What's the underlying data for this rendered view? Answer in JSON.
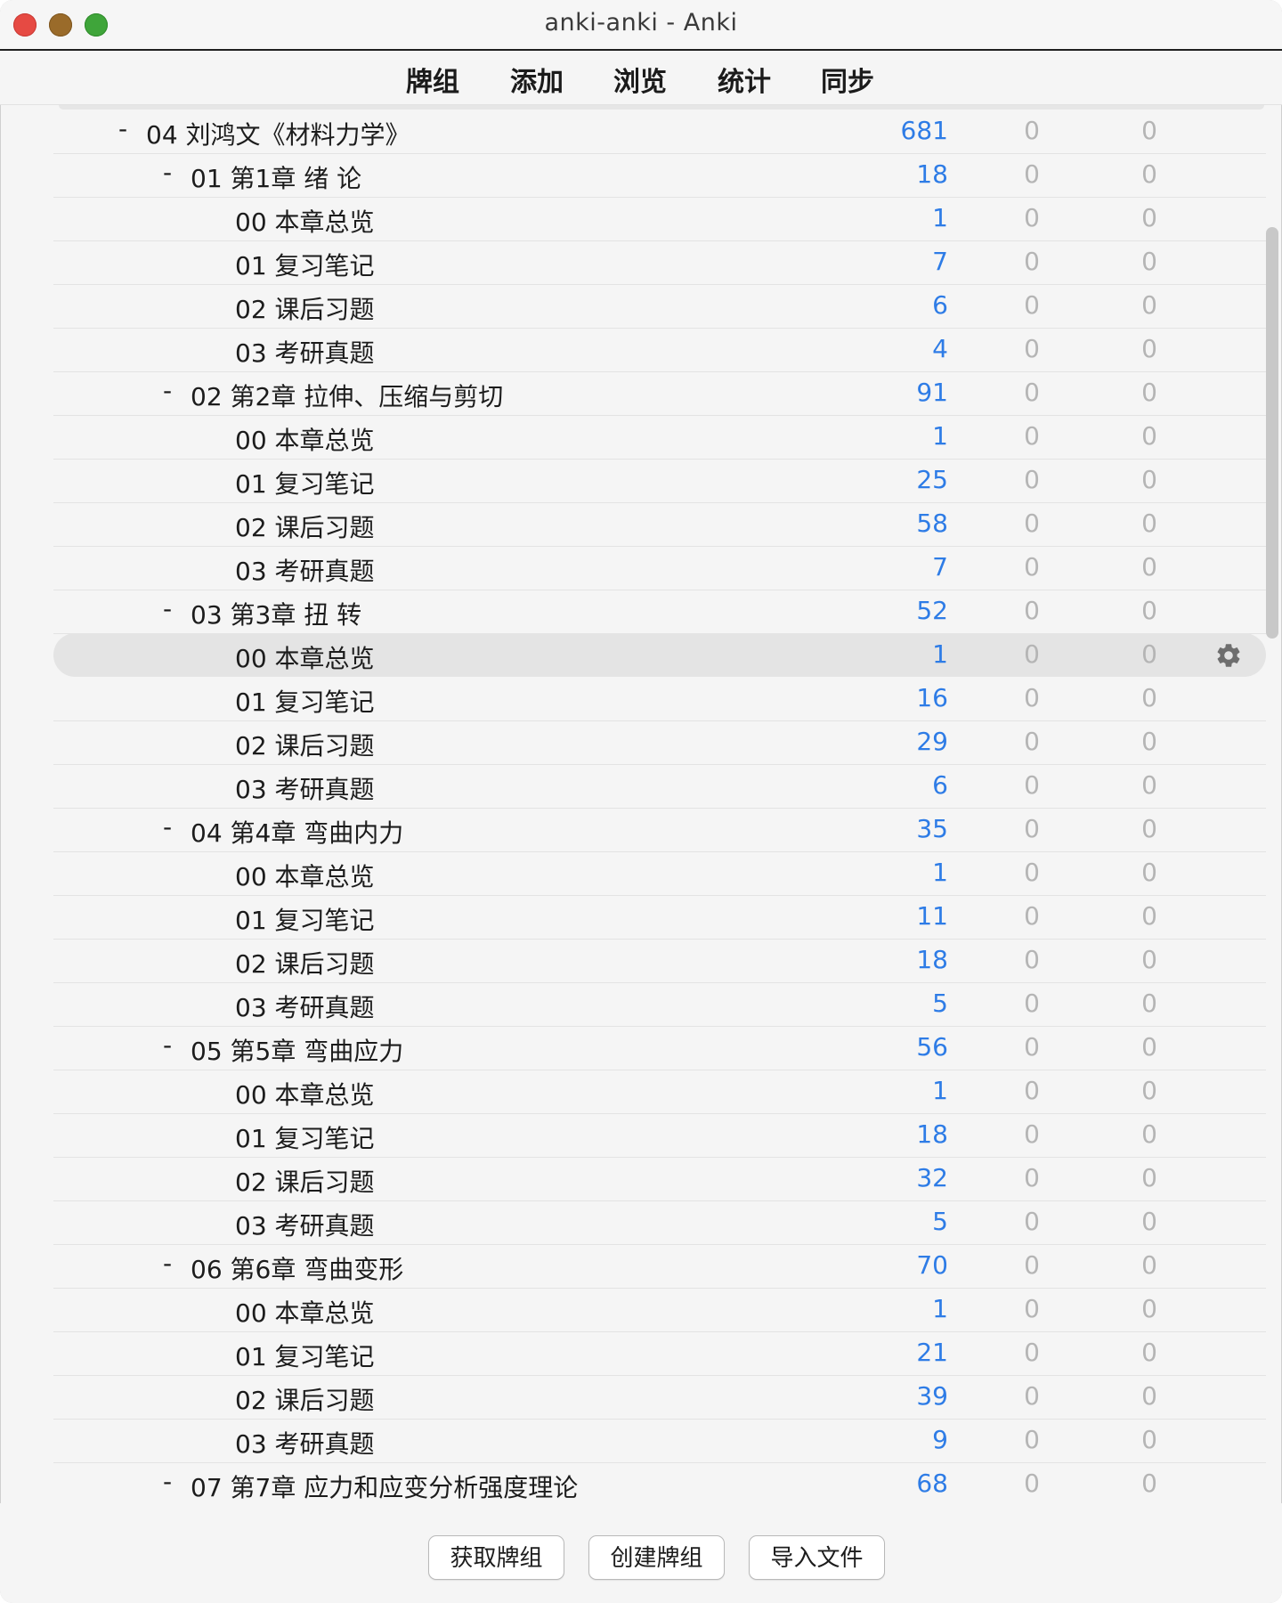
{
  "window": {
    "title": "anki-anki - Anki"
  },
  "toolbar": {
    "decks": "牌组",
    "add": "添加",
    "browse": "浏览",
    "stats": "统计",
    "sync": "同步"
  },
  "decks": [
    {
      "level": 0,
      "collapse": "-",
      "name": "04 刘鸿文《材料力学》",
      "new": "681",
      "learn": "0",
      "due": "0"
    },
    {
      "level": 1,
      "collapse": "-",
      "name": "01 第1章 绪 论",
      "new": "18",
      "learn": "0",
      "due": "0"
    },
    {
      "level": 2,
      "collapse": "",
      "name": "00 本章总览",
      "new": "1",
      "learn": "0",
      "due": "0"
    },
    {
      "level": 2,
      "collapse": "",
      "name": "01 复习笔记",
      "new": "7",
      "learn": "0",
      "due": "0"
    },
    {
      "level": 2,
      "collapse": "",
      "name": "02 课后习题",
      "new": "6",
      "learn": "0",
      "due": "0"
    },
    {
      "level": 2,
      "collapse": "",
      "name": "03 考研真题",
      "new": "4",
      "learn": "0",
      "due": "0"
    },
    {
      "level": 1,
      "collapse": "-",
      "name": "02 第2章 拉伸、压缩与剪切",
      "new": "91",
      "learn": "0",
      "due": "0"
    },
    {
      "level": 2,
      "collapse": "",
      "name": "00 本章总览",
      "new": "1",
      "learn": "0",
      "due": "0"
    },
    {
      "level": 2,
      "collapse": "",
      "name": "01 复习笔记",
      "new": "25",
      "learn": "0",
      "due": "0"
    },
    {
      "level": 2,
      "collapse": "",
      "name": "02 课后习题",
      "new": "58",
      "learn": "0",
      "due": "0"
    },
    {
      "level": 2,
      "collapse": "",
      "name": "03 考研真题",
      "new": "7",
      "learn": "0",
      "due": "0"
    },
    {
      "level": 1,
      "collapse": "-",
      "name": "03 第3章 扭 转",
      "new": "52",
      "learn": "0",
      "due": "0"
    },
    {
      "level": 2,
      "collapse": "",
      "name": "00 本章总览",
      "new": "1",
      "learn": "0",
      "due": "0",
      "selected": true
    },
    {
      "level": 2,
      "collapse": "",
      "name": "01 复习笔记",
      "new": "16",
      "learn": "0",
      "due": "0"
    },
    {
      "level": 2,
      "collapse": "",
      "name": "02 课后习题",
      "new": "29",
      "learn": "0",
      "due": "0"
    },
    {
      "level": 2,
      "collapse": "",
      "name": "03 考研真题",
      "new": "6",
      "learn": "0",
      "due": "0"
    },
    {
      "level": 1,
      "collapse": "-",
      "name": "04 第4章 弯曲内力",
      "new": "35",
      "learn": "0",
      "due": "0"
    },
    {
      "level": 2,
      "collapse": "",
      "name": "00 本章总览",
      "new": "1",
      "learn": "0",
      "due": "0"
    },
    {
      "level": 2,
      "collapse": "",
      "name": "01 复习笔记",
      "new": "11",
      "learn": "0",
      "due": "0"
    },
    {
      "level": 2,
      "collapse": "",
      "name": "02 课后习题",
      "new": "18",
      "learn": "0",
      "due": "0"
    },
    {
      "level": 2,
      "collapse": "",
      "name": "03 考研真题",
      "new": "5",
      "learn": "0",
      "due": "0"
    },
    {
      "level": 1,
      "collapse": "-",
      "name": "05 第5章 弯曲应力",
      "new": "56",
      "learn": "0",
      "due": "0"
    },
    {
      "level": 2,
      "collapse": "",
      "name": "00 本章总览",
      "new": "1",
      "learn": "0",
      "due": "0"
    },
    {
      "level": 2,
      "collapse": "",
      "name": "01 复习笔记",
      "new": "18",
      "learn": "0",
      "due": "0"
    },
    {
      "level": 2,
      "collapse": "",
      "name": "02 课后习题",
      "new": "32",
      "learn": "0",
      "due": "0"
    },
    {
      "level": 2,
      "collapse": "",
      "name": "03 考研真题",
      "new": "5",
      "learn": "0",
      "due": "0"
    },
    {
      "level": 1,
      "collapse": "-",
      "name": "06 第6章 弯曲变形",
      "new": "70",
      "learn": "0",
      "due": "0"
    },
    {
      "level": 2,
      "collapse": "",
      "name": "00 本章总览",
      "new": "1",
      "learn": "0",
      "due": "0"
    },
    {
      "level": 2,
      "collapse": "",
      "name": "01 复习笔记",
      "new": "21",
      "learn": "0",
      "due": "0"
    },
    {
      "level": 2,
      "collapse": "",
      "name": "02 课后习题",
      "new": "39",
      "learn": "0",
      "due": "0"
    },
    {
      "level": 2,
      "collapse": "",
      "name": "03 考研真题",
      "new": "9",
      "learn": "0",
      "due": "0"
    },
    {
      "level": 1,
      "collapse": "-",
      "name": "07 第7章 应力和应变分析强度理论",
      "new": "68",
      "learn": "0",
      "due": "0"
    }
  ],
  "buttons": {
    "get_shared": "获取牌组",
    "create_deck": "创建牌组",
    "import_file": "导入文件"
  },
  "colors": {
    "new_count": "#2e7ce6",
    "zero_count": "#b5b5b5",
    "selected_row": "#e4e4e4"
  },
  "icons": {
    "deck_options": "gear-icon"
  }
}
